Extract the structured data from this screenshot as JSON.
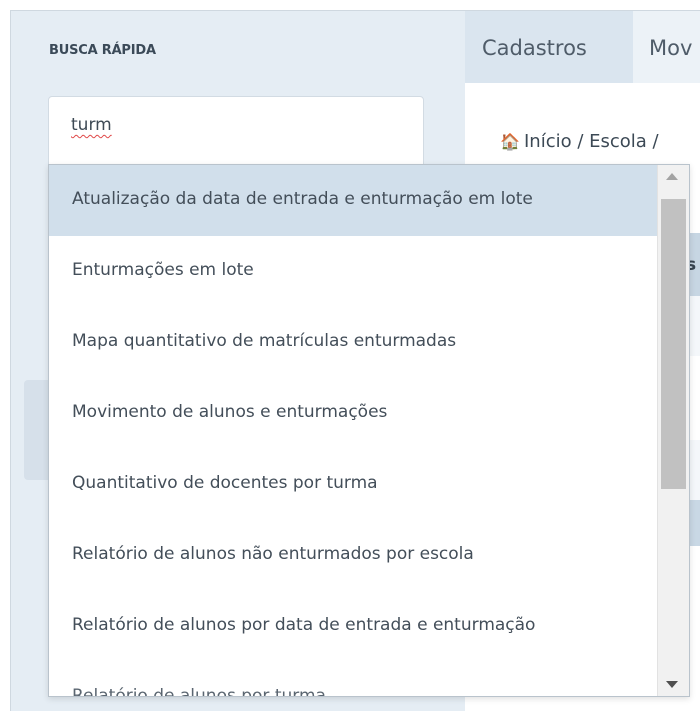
{
  "sidebar": {
    "title": "BUSCA RÁPIDA"
  },
  "search": {
    "value": "turm"
  },
  "tabs": [
    {
      "label": "Cadastros"
    },
    {
      "label": "Mov"
    }
  ],
  "breadcrumb": {
    "text": "Início / Escola /"
  },
  "main": {
    "header_fragment": "s"
  },
  "dropdown": {
    "items": [
      {
        "label": "Atualização da data de entrada e enturmação em lote"
      },
      {
        "label": "Enturmações em lote"
      },
      {
        "label": "Mapa quantitativo de matrículas enturmadas"
      },
      {
        "label": "Movimento de alunos e enturmações"
      },
      {
        "label": "Quantitativo de docentes por turma"
      },
      {
        "label": "Relatório de alunos não enturmados por escola"
      },
      {
        "label": "Relatório de alunos por data de entrada e enturmação"
      },
      {
        "label": "Relatório de alunos por turma"
      }
    ],
    "scroll_position": 0.0
  },
  "colors": {
    "sidebar_bg": "#e5edf4",
    "active_item_bg": "#d1dfeb",
    "tab_active_bg": "#dae5ef",
    "spellcheck_underline": "#e04848"
  }
}
